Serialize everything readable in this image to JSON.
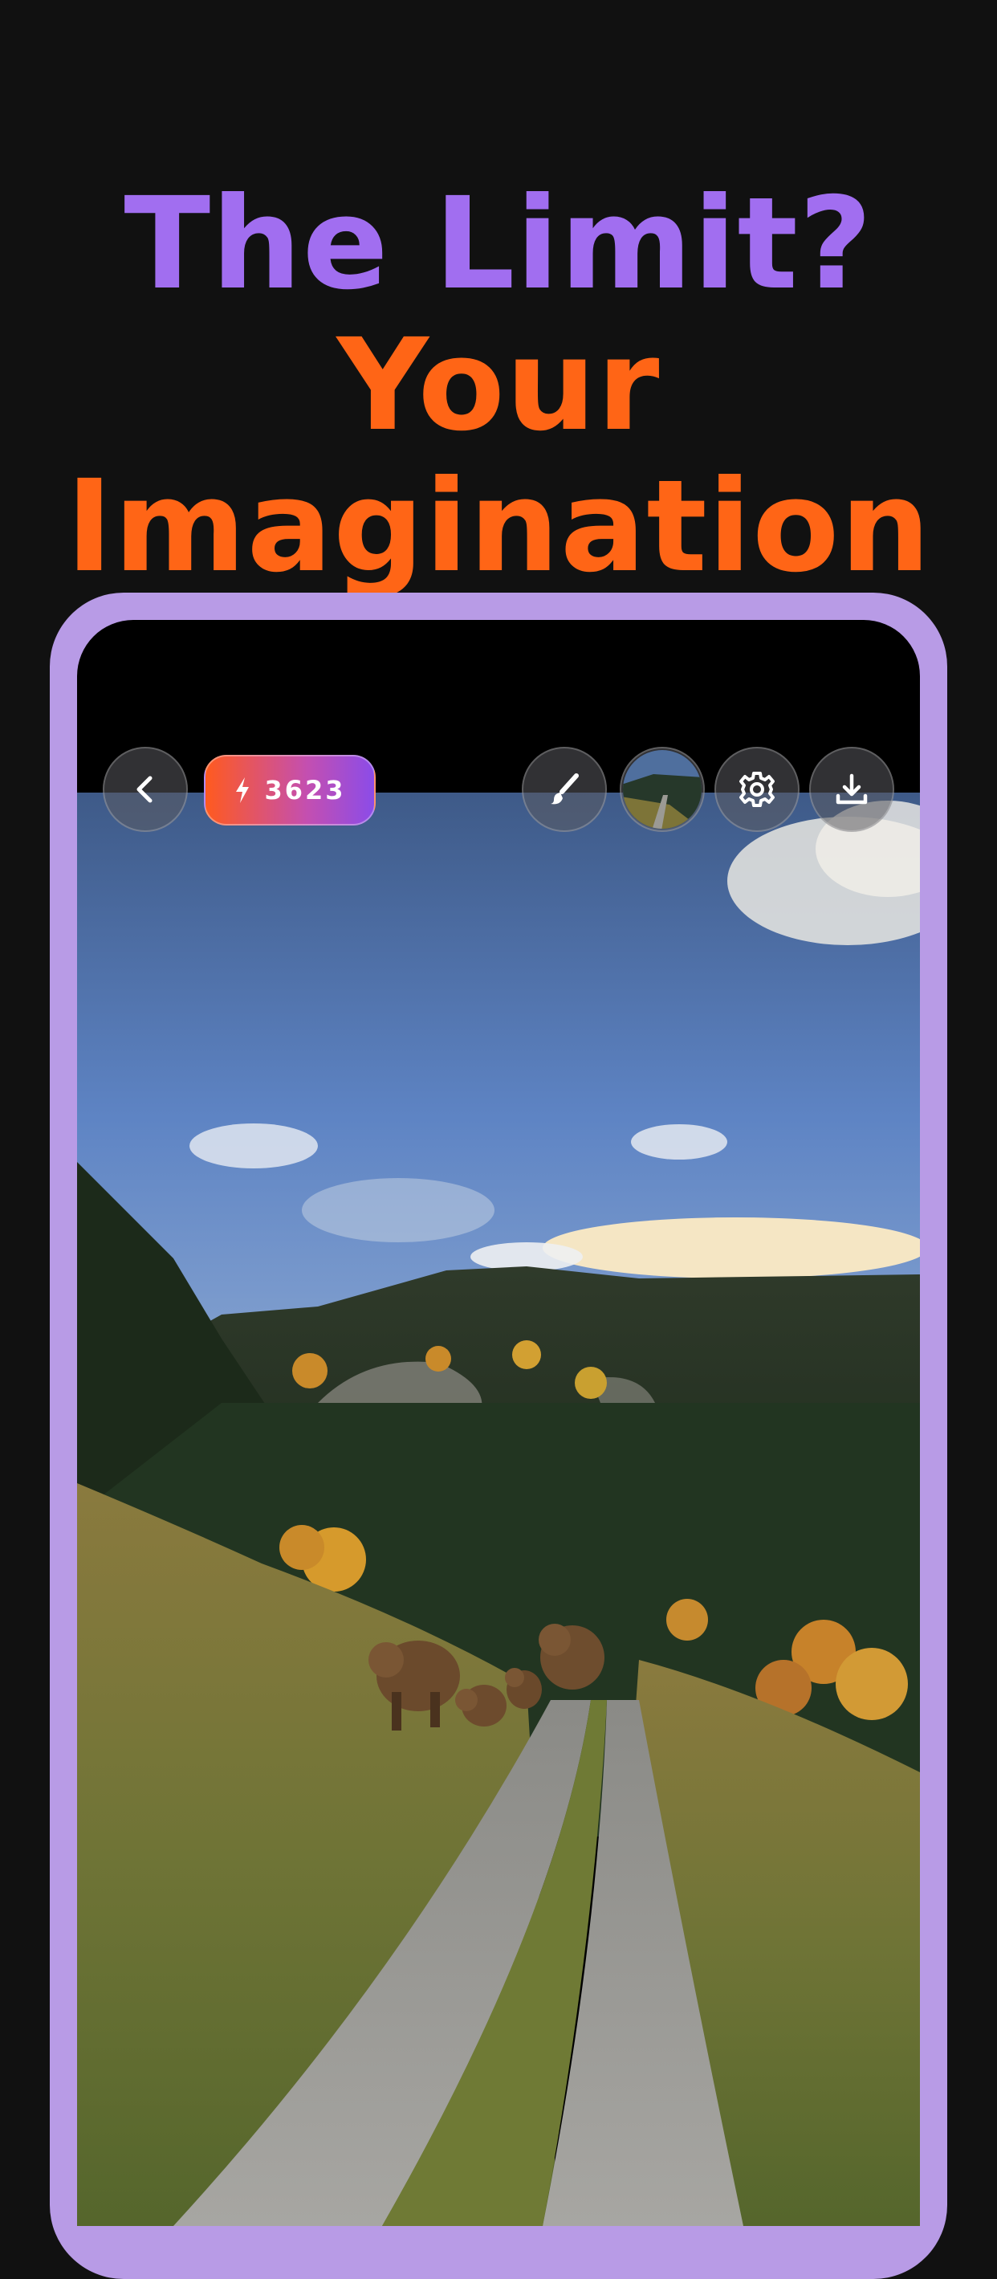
{
  "headline": {
    "line1": "The Limit?",
    "line2": "Your",
    "line3": "Imagination"
  },
  "colors": {
    "headline_purple": "#a16ef0",
    "headline_orange": "#ff6516",
    "frame": "#b89be6",
    "background": "#111111"
  },
  "toolbar": {
    "credits": "3623",
    "icons": [
      "chevron-left-icon",
      "lightning-icon",
      "brush-icon",
      "image-thumbnail",
      "gear-icon",
      "download-icon"
    ]
  }
}
